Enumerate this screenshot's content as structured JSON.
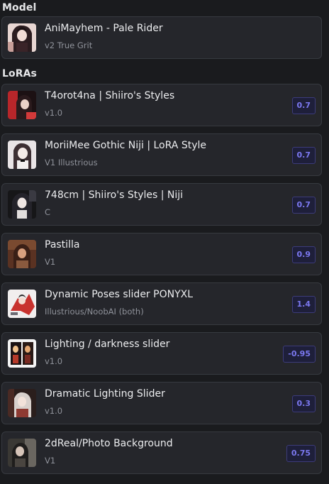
{
  "model_section": {
    "title": "Model",
    "item": {
      "name": "AniMayhem - Pale Rider",
      "version": "v2 True Grit",
      "thumb_icon": "model-thumbnail"
    }
  },
  "loras_section": {
    "title": "LoRAs",
    "items": [
      {
        "name": "T4orot4na | Shiiro's Styles",
        "version": "v1.0",
        "weight": "0.7"
      },
      {
        "name": "MoriiMee Gothic Niji | LoRA Style",
        "version": "V1 Illustrious",
        "weight": "0.7"
      },
      {
        "name": "748cm | Shiiro's Styles | Niji",
        "version": "C",
        "weight": "0.7"
      },
      {
        "name": "Pastilla",
        "version": "V1",
        "weight": "0.9"
      },
      {
        "name": "Dynamic Poses slider PONYXL",
        "version": "Illustrious/NoobAI (both)",
        "weight": "1.4"
      },
      {
        "name": "Lighting / darkness slider",
        "version": "v1.0",
        "weight": "-0.95"
      },
      {
        "name": "Dramatic Lighting Slider",
        "version": "v1.0",
        "weight": "0.3"
      },
      {
        "name": "2dReal/Photo Background",
        "version": "V1",
        "weight": "0.75"
      }
    ]
  },
  "colors": {
    "background": "#1a1b1e",
    "card": "#25262b",
    "accent": "#7b78f0"
  }
}
